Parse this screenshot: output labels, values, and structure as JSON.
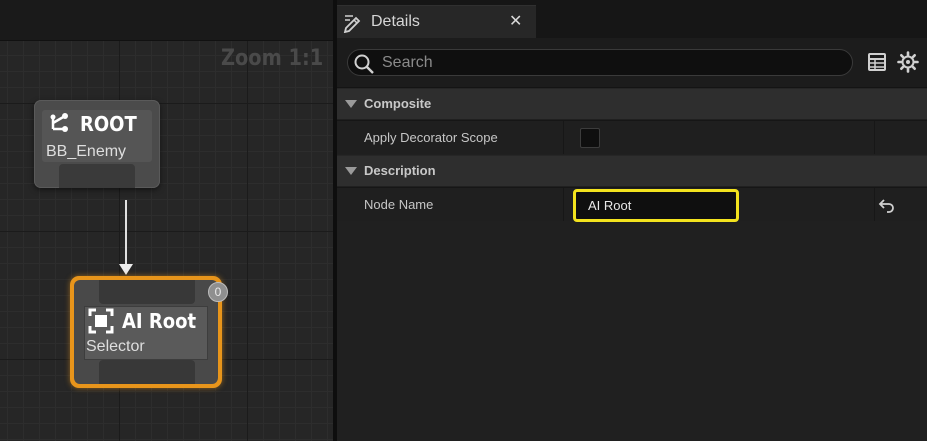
{
  "graph": {
    "zoom_label": "Zoom 1:1",
    "nodes": [
      {
        "title": "ROOT",
        "subtitle": "BB_Enemy",
        "icon": "root-tree-icon"
      },
      {
        "title": "AI Root",
        "subtitle": "Selector",
        "icon": "selector-icon",
        "badge": "0",
        "selected": true
      }
    ],
    "colors": {
      "selection": "#e8951b",
      "wire": "#e0e0e0"
    }
  },
  "details": {
    "tab": {
      "title": "Details",
      "icon": "pencil-icon",
      "close_icon": "close-icon"
    },
    "search": {
      "placeholder": "Search",
      "value": ""
    },
    "toolbar_icons": [
      "table-icon",
      "gear-icon"
    ],
    "categories": [
      {
        "label": "Composite",
        "properties": [
          {
            "label": "Apply Decorator Scope",
            "type": "checkbox",
            "value": false
          }
        ]
      },
      {
        "label": "Description",
        "properties": [
          {
            "label": "Node Name",
            "type": "text",
            "value": "AI Root",
            "reset_icon": "reset-arrow-icon"
          }
        ]
      }
    ],
    "colors": {
      "focus_border": "#f3e31e"
    }
  }
}
